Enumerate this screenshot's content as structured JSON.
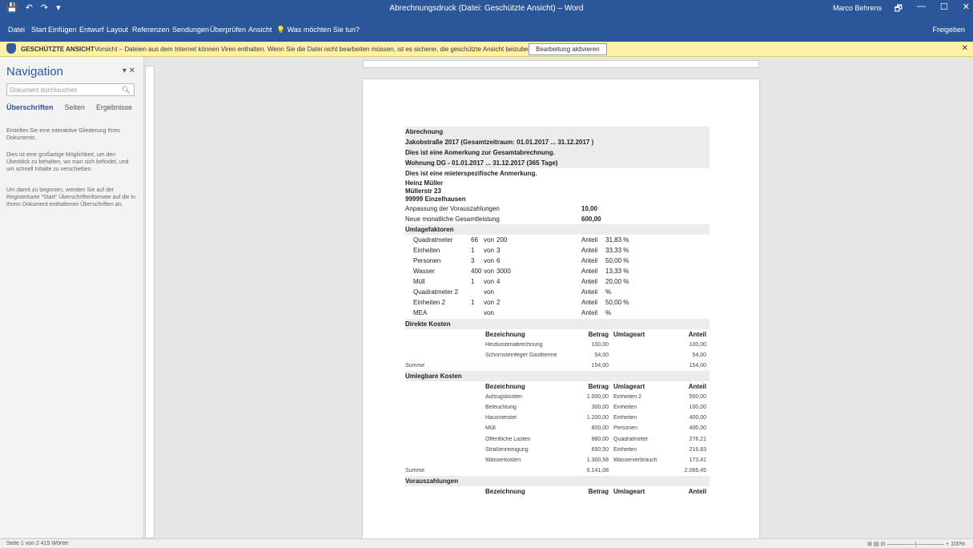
{
  "window": {
    "title": "Abrechnungsdruck (Datei: Geschützte Ansicht) – Word",
    "user": "Marco Behrens",
    "qat": [
      "💾",
      "↶",
      "↷",
      "▾"
    ],
    "controls": [
      "🗗",
      "—",
      "☐",
      "✕"
    ]
  },
  "ribbon": {
    "tabs": [
      "Datei",
      "Start",
      "Einfügen",
      "Entwurf",
      "Layout",
      "Referenzen",
      "Sendungen",
      "Überprüfen",
      "Ansicht",
      "💡 Was möchten Sie tun?"
    ],
    "right": "Freigeben"
  },
  "infobar": {
    "label": "GESCHÜTZTE ANSICHT",
    "message": "Vorsicht – Dateien aus dem Internet können Viren enthalten. Wenn Sie die Datei nicht bearbeiten müssen, ist es sicherer, die geschützte Ansicht beizubehalten.",
    "button": "Bearbeitung aktivieren",
    "close": "✕"
  },
  "nav": {
    "title": "Navigation",
    "controls": "▾  ✕",
    "search_placeholder": "Dokument durchsuchen",
    "search_icon": "search-icon",
    "tabs": [
      "Überschriften",
      "Seiten",
      "Ergebnisse"
    ],
    "paragraphs": [
      "Erstellen Sie eine interaktive Gliederung Ihres Dokuments.",
      "Dies ist eine großartige Möglichkeit, um den Überblick zu behalten, wo man sich befindet, und um schnell Inhalte zu verschieben.",
      "Um damit zu beginnen, wenden Sie auf der Registerkarte \"Start\" Überschriftenformate auf die in Ihrem Dokument enthaltenen Überschriften an."
    ]
  },
  "status": {
    "left": "Seite 1 von 2    415 Wörter",
    "right": "⊞  ▤  ⊟   —————|—————  +  100%"
  },
  "document": {
    "heading": "Abrechnung",
    "period": "Jakobstraße 2017  (Gesamtzeitraum: 01.01.2017 ... 31.12.2017 )",
    "note_total": "Dies ist eine Anmerkung zur Gesamtabrechnung.",
    "unit": "Wohnung DG -  01.01.2017 ... 31.12.2017 (365 Tage)",
    "note_tenant": "Dies ist eine mieterspezifische Anmerkung.",
    "tenant": [
      "Heinz Müller",
      "Müllerstr 23",
      "99999 Einzelhausen"
    ],
    "adjustment_label": "Anpassung der Vorauszahlungen",
    "adjustment_value": "10,00",
    "monthly_label": "Neue monatliche Gesamtleistung",
    "monthly_value": "600,00",
    "factors_heading": "Umlagefaktoren",
    "factors": [
      {
        "name": "Quadratmeter",
        "n": "66",
        "sep": "von",
        "total": "200",
        "label": "Anteil",
        "pct": "31,83 %"
      },
      {
        "name": "Einheiten",
        "n": "1",
        "sep": "von",
        "total": "3",
        "label": "Anteil",
        "pct": "33,33 %"
      },
      {
        "name": "Personen",
        "n": "3",
        "sep": "von",
        "total": "6",
        "label": "Anteil",
        "pct": "50,00 %"
      },
      {
        "name": "Wasser",
        "n": "400",
        "sep": "von",
        "total": "3000",
        "label": "Anteil",
        "pct": "13,33 %"
      },
      {
        "name": "Müll",
        "n": "1",
        "sep": "von",
        "total": "4",
        "label": "Anteil",
        "pct": "20,00 %"
      },
      {
        "name": "Quadratmeter 2",
        "n": "",
        "sep": "von",
        "total": "",
        "label": "Anteil",
        "pct": "%"
      },
      {
        "name": "Einheiten 2",
        "n": "1",
        "sep": "von",
        "total": "2",
        "label": "Anteil",
        "pct": "50,00 %"
      },
      {
        "name": "MEA",
        "n": "",
        "sep": "von",
        "total": "",
        "label": "Anteil",
        "pct": "%"
      }
    ],
    "direct_heading": "Direkte Kosten",
    "columns": [
      "Bezeichnung",
      "Betrag",
      "Umlageart",
      "Anteil"
    ],
    "direct_rows": [
      {
        "name": "Heizkostenabrechnung",
        "amount": "100,00",
        "type": "",
        "share": "100,00"
      },
      {
        "name": "Schornsteinfeger Gastherme",
        "amount": "54,00",
        "type": "",
        "share": "54,00"
      }
    ],
    "sum_label": "Summe",
    "direct_sum": {
      "amount": "154,00",
      "share": "154,00"
    },
    "alloc_heading": "Umlegbare Kosten",
    "alloc_rows": [
      {
        "name": "Aufzugskosten",
        "amount": "1.000,00",
        "type": "Einheiten 2",
        "share": "500,00"
      },
      {
        "name": "Beleuchtung",
        "amount": "300,00",
        "type": "Einheiten",
        "share": "100,00"
      },
      {
        "name": "Hausmeister",
        "amount": "1.200,00",
        "type": "Einheiten",
        "share": "400,00"
      },
      {
        "name": "Müll",
        "amount": "800,00",
        "type": "Personen",
        "share": "400,00"
      },
      {
        "name": "Öffentliche Lasten",
        "amount": "880,00",
        "type": "Quadratmeter",
        "share": "276,21"
      },
      {
        "name": "Straßenreinigung",
        "amount": "650,50",
        "type": "Einheiten",
        "share": "216,83"
      },
      {
        "name": "Wasserkosten",
        "amount": "1.300,58",
        "type": "Wasserverbrauch",
        "share": "173,41"
      }
    ],
    "alloc_sum": {
      "amount": "6.141,08",
      "share": "2.066,45"
    },
    "prepay_heading": "Vorauszahlungen"
  }
}
